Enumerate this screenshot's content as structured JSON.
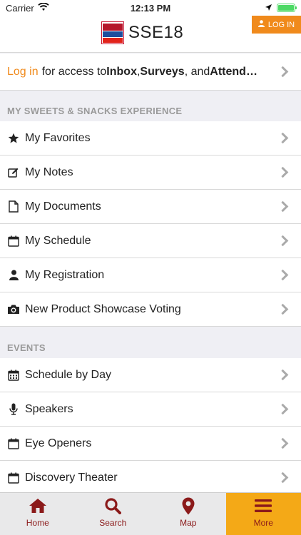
{
  "status_bar": {
    "carrier": "Carrier",
    "time": "12:13 PM"
  },
  "header": {
    "title": "SSE18",
    "login_button": "LOG IN",
    "logo_lines": [
      "sweets",
      "snacks",
      "2018"
    ]
  },
  "login_prompt": {
    "link": "Log in",
    "text1": "for access to ",
    "b1": "Inbox",
    "sep1": ", ",
    "b2": "Surveys",
    "sep2": ", and ",
    "b3": "Attend…"
  },
  "sections": [
    {
      "title": "MY SWEETS & SNACKS EXPERIENCE",
      "items": [
        {
          "label": "My Favorites",
          "icon": "star-icon"
        },
        {
          "label": "My Notes",
          "icon": "edit-icon"
        },
        {
          "label": "My Documents",
          "icon": "document-icon"
        },
        {
          "label": "My Schedule",
          "icon": "calendar-icon"
        },
        {
          "label": "My Registration",
          "icon": "user-icon"
        },
        {
          "label": "New Product Showcase Voting",
          "icon": "camera-icon"
        }
      ]
    },
    {
      "title": "EVENTS",
      "items": [
        {
          "label": "Schedule by Day",
          "icon": "calendar-grid-icon"
        },
        {
          "label": "Speakers",
          "icon": "microphone-icon"
        },
        {
          "label": "Eye Openers",
          "icon": "calendar-icon"
        },
        {
          "label": "Discovery Theater",
          "icon": "calendar-icon"
        }
      ]
    }
  ],
  "tabbar": {
    "tabs": [
      {
        "label": "Home",
        "icon": "home-icon"
      },
      {
        "label": "Search",
        "icon": "search-icon"
      },
      {
        "label": "Map",
        "icon": "map-pin-icon"
      },
      {
        "label": "More",
        "icon": "menu-icon",
        "active": true
      }
    ]
  },
  "colors": {
    "accent": "#f08a1c",
    "tab_active": "#f4a917",
    "tab_icon": "#8b1a1a"
  }
}
